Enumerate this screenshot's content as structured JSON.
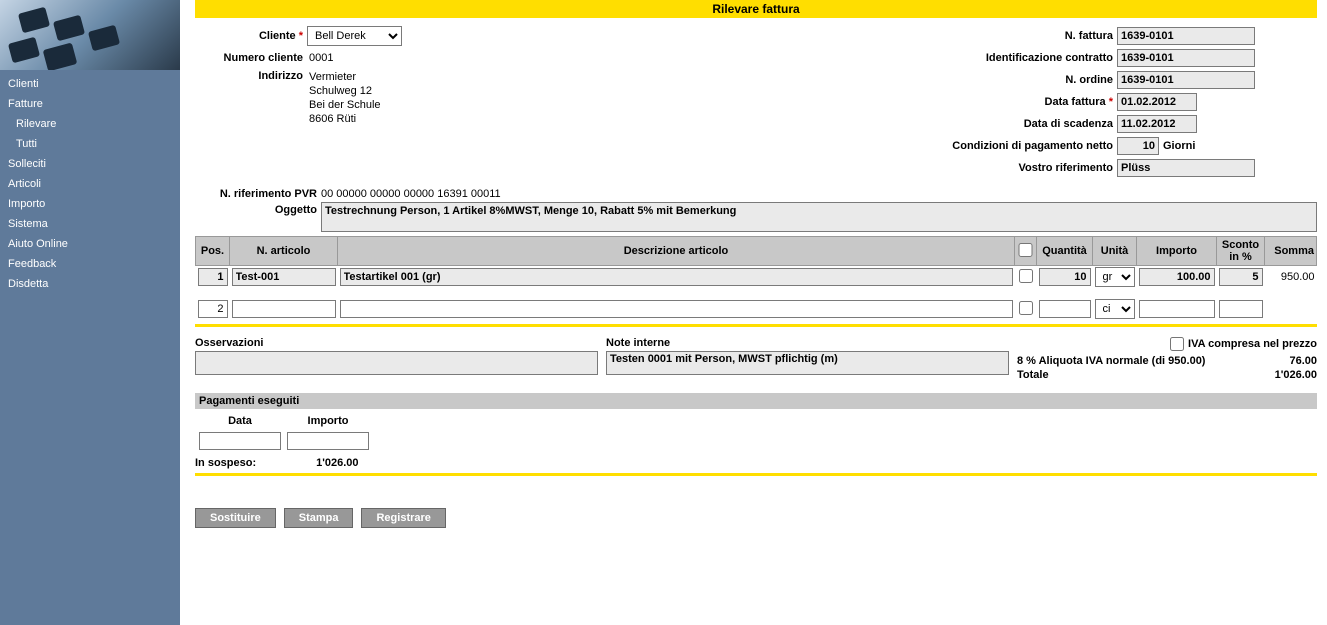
{
  "title_bar": "Rilevare fattura",
  "sidebar": {
    "items": [
      {
        "label": "Clienti"
      },
      {
        "label": "Fatture"
      },
      {
        "label": "Rilevare",
        "sub": true
      },
      {
        "label": "Tutti",
        "sub": true
      },
      {
        "label": "Solleciti"
      },
      {
        "label": "Articoli"
      },
      {
        "label": "Importo"
      },
      {
        "label": "Sistema"
      },
      {
        "label": "Aiuto Online"
      },
      {
        "label": "Feedback"
      },
      {
        "label": "Disdetta"
      }
    ]
  },
  "labels": {
    "cliente": "Cliente",
    "numero_cliente": "Numero cliente",
    "indirizzo": "Indirizzo",
    "n_fattura": "N. fattura",
    "id_contratto": "Identificazione contratto",
    "n_ordine": "N. ordine",
    "data_fattura": "Data fattura",
    "data_scadenza": "Data di scadenza",
    "cond_pagamento": "Condizioni di pagamento netto",
    "giorni": "Giorni",
    "vostro_rif": "Vostro riferimento",
    "pvr": "N. riferimento PVR",
    "oggetto": "Oggetto",
    "osservazioni": "Osservazioni",
    "note_interne": "Note interne",
    "iva_compresa": "IVA compresa nel prezzo",
    "pag_eseguiti": "Pagamenti eseguiti",
    "data": "Data",
    "importo": "Importo",
    "in_sospeso": "In sospeso:",
    "totale": "Totale"
  },
  "header_th": {
    "pos": "Pos.",
    "n_articolo": "N. articolo",
    "descrizione": "Descrizione articolo",
    "quantita": "Quantità",
    "unita": "Unità",
    "importo": "Importo",
    "sconto": "Sconto in %",
    "somma": "Somma"
  },
  "client": {
    "selected": "Bell Derek",
    "number": "0001",
    "line1": "Vermieter",
    "line2": "Schulweg 12",
    "line3": "Bei der Schule",
    "line4": "8606 Rüti"
  },
  "invoice": {
    "number": "1639-0101",
    "contract_id": "1639-0101",
    "order": "1639-0101",
    "date": "01.02.2012",
    "due_date": "11.02.2012",
    "pay_days": "10",
    "your_ref": "Plüss",
    "pvr": "00 00000 00000 00000 16391 00011",
    "subject": "Testrechnung Person, 1 Artikel 8%MWST, Menge 10, Rabatt 5% mit Bemerkung"
  },
  "lines": [
    {
      "pos": "1",
      "article": "Test-001",
      "desc": "Testartikel 001 (gr)",
      "qty": "10",
      "unit": "gr",
      "price": "100.00",
      "disc": "5",
      "sum": "950.00"
    },
    {
      "pos": "2",
      "article": "",
      "desc": "",
      "qty": "",
      "unit": "ci",
      "price": "",
      "disc": "",
      "sum": ""
    }
  ],
  "notes": {
    "observations": "",
    "internal": "Testen 0001 mit Person, MWST pflichtig (m)"
  },
  "totals": {
    "iva_rate_label": "8 % Aliquota IVA normale (di 950.00)",
    "iva_amount": "76.00",
    "total": "1'026.00"
  },
  "payments": {
    "date": "",
    "amount": "",
    "outstanding": "1'026.00"
  },
  "buttons": {
    "sostituire": "Sostituire",
    "stampa": "Stampa",
    "registrare": "Registrare"
  }
}
